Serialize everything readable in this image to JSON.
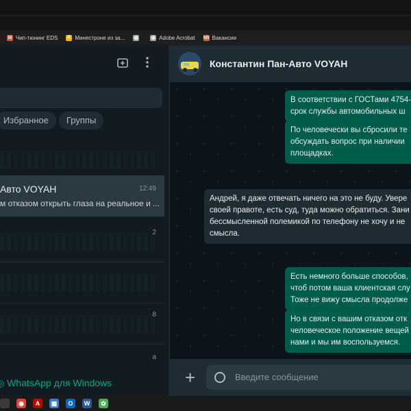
{
  "bookmarks": [
    {
      "label": "Чип-тюнинг EDS",
      "icon": "gmail-icon",
      "color": "#ea4335",
      "glyph": "M"
    },
    {
      "label": "Минестроне из за...",
      "icon": "bookmark-f-icon",
      "color": "#f5b400",
      "glyph": "F"
    },
    {
      "label": "",
      "icon": "globe-icon",
      "color": "#9aa0a6",
      "glyph": "◍"
    },
    {
      "label": "Adobe Acrobat",
      "icon": "globe-icon",
      "color": "#9aa0a6",
      "glyph": "◍"
    },
    {
      "label": "Вакансии",
      "icon": "hh-icon",
      "color": "#e8541f",
      "glyph": "hh"
    }
  ],
  "sidebar": {
    "filters": [
      "Избранное",
      "Группы"
    ],
    "chats": [
      {
        "num": ""
      },
      {
        "name": "Авто VOYAH",
        "time": "12:49",
        "preview": "м отказом открыть глаза на реальное и ..."
      },
      {
        "num": "2"
      },
      {
        "num": ""
      },
      {
        "num": "8"
      },
      {
        "num": "a"
      }
    ],
    "footer": "WhatsApp для Windows"
  },
  "chat": {
    "contact_name": "Константин Пан-Авто VOYAH",
    "messages": [
      {
        "dir": "out",
        "text": "В соответствии с ГОСТами 4754-\nсрок службы автомобильных ш"
      },
      {
        "dir": "out",
        "text": "По человечески вы сбросили те\nобсуждать вопрос при наличии\nплощадках."
      },
      {
        "dir": "in",
        "text": "Андрей, я даже отвечать ничего на это не буду. Увере\nсвоей правоте, есть суд, туда можно обратиться. Зани\nбессмысленной полемикой по телефону не хочу и не\nсмысла."
      },
      {
        "dir": "out",
        "text": "Есть немного больше способов,\nчтоб потом ваша клиентская слу\nТоже не вижу смысла продолже"
      },
      {
        "dir": "out",
        "text": "Но в связи с вашим отказом отк\nчеловеческое положение вещей\nнами и мы им воспользуемся."
      }
    ],
    "composer_placeholder": "Введите сообщение"
  },
  "taskbar": [
    {
      "icon": "windows-icon",
      "color": "#3a3a3a",
      "glyph": ""
    },
    {
      "icon": "chrome-icon",
      "color": "#db4437",
      "glyph": "◉"
    },
    {
      "icon": "acrobat-icon",
      "color": "#b30b00",
      "glyph": "A"
    },
    {
      "icon": "store-icon",
      "color": "#3b7bd4",
      "glyph": "▦"
    },
    {
      "icon": "outlook-icon",
      "color": "#0a64c2",
      "glyph": "O"
    },
    {
      "icon": "word-icon",
      "color": "#2b579a",
      "glyph": "W"
    },
    {
      "icon": "app-icon",
      "color": "#4caf50",
      "glyph": "✿"
    }
  ]
}
